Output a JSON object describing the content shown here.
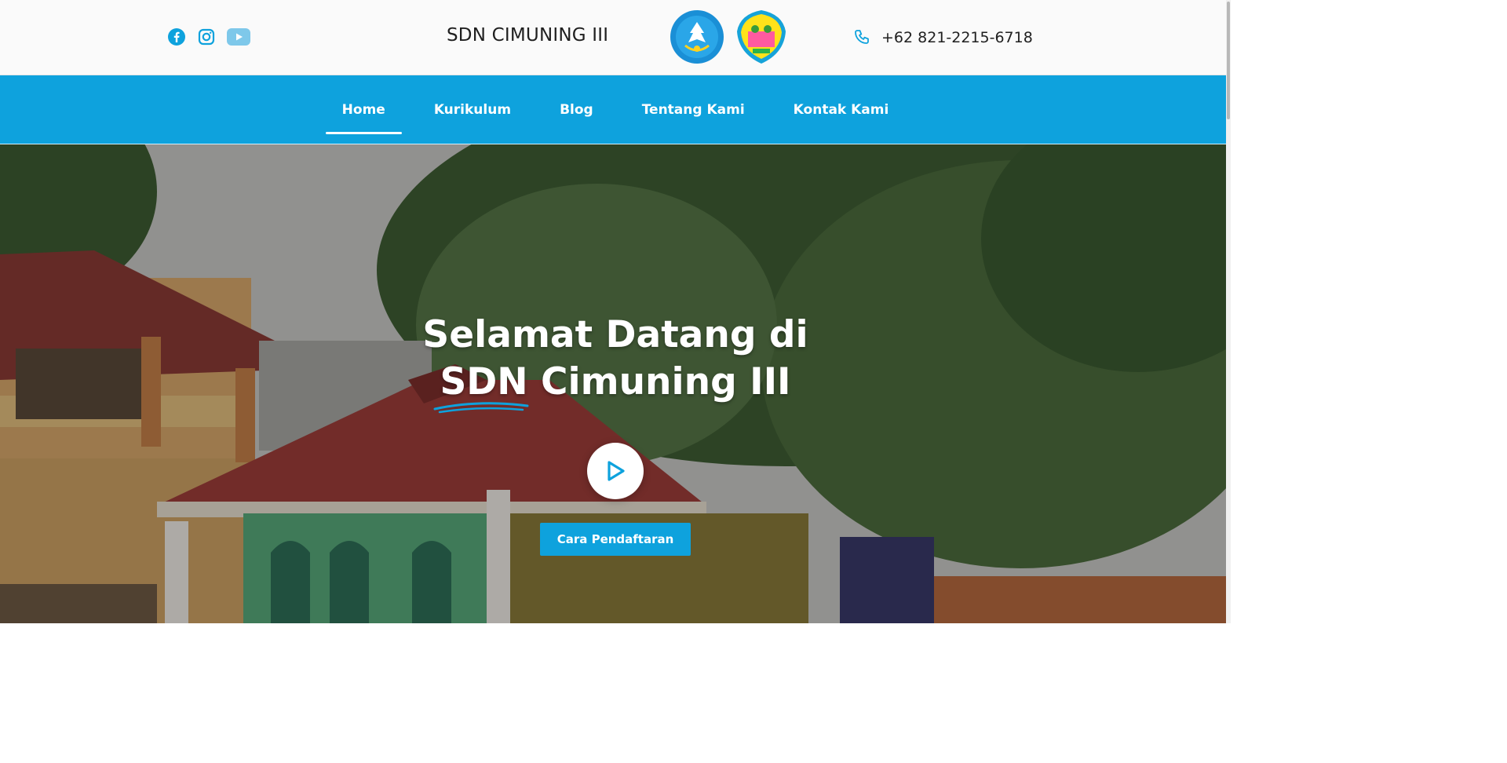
{
  "header": {
    "social": [
      {
        "icon": "facebook-icon",
        "color": "#0ea2dd"
      },
      {
        "icon": "instagram-icon",
        "color": "#0ea2dd"
      },
      {
        "icon": "youtube-icon",
        "color": "#7ec8ea"
      }
    ],
    "site_title": "SDN CIMUNING III",
    "logos": [
      "tut-wuri-handayani-logo",
      "kota-bekasi-logo"
    ],
    "phone": "+62 821-2215-6718"
  },
  "nav": {
    "items": [
      {
        "label": "Home",
        "active": true
      },
      {
        "label": "Kurikulum",
        "active": false
      },
      {
        "label": "Blog",
        "active": false
      },
      {
        "label": "Tentang Kami",
        "active": false
      },
      {
        "label": "Kontak Kami",
        "active": false
      }
    ]
  },
  "hero": {
    "title_line1": "Selamat Datang di",
    "title_highlight": "SDN",
    "title_rest": " Cimuning III",
    "cta_label": "Cara Pendaftaran",
    "play_icon": "play-icon"
  },
  "colors": {
    "brand": "#0ea2dd",
    "title": "#1f1f1f",
    "hero_text": "#ffffff"
  }
}
